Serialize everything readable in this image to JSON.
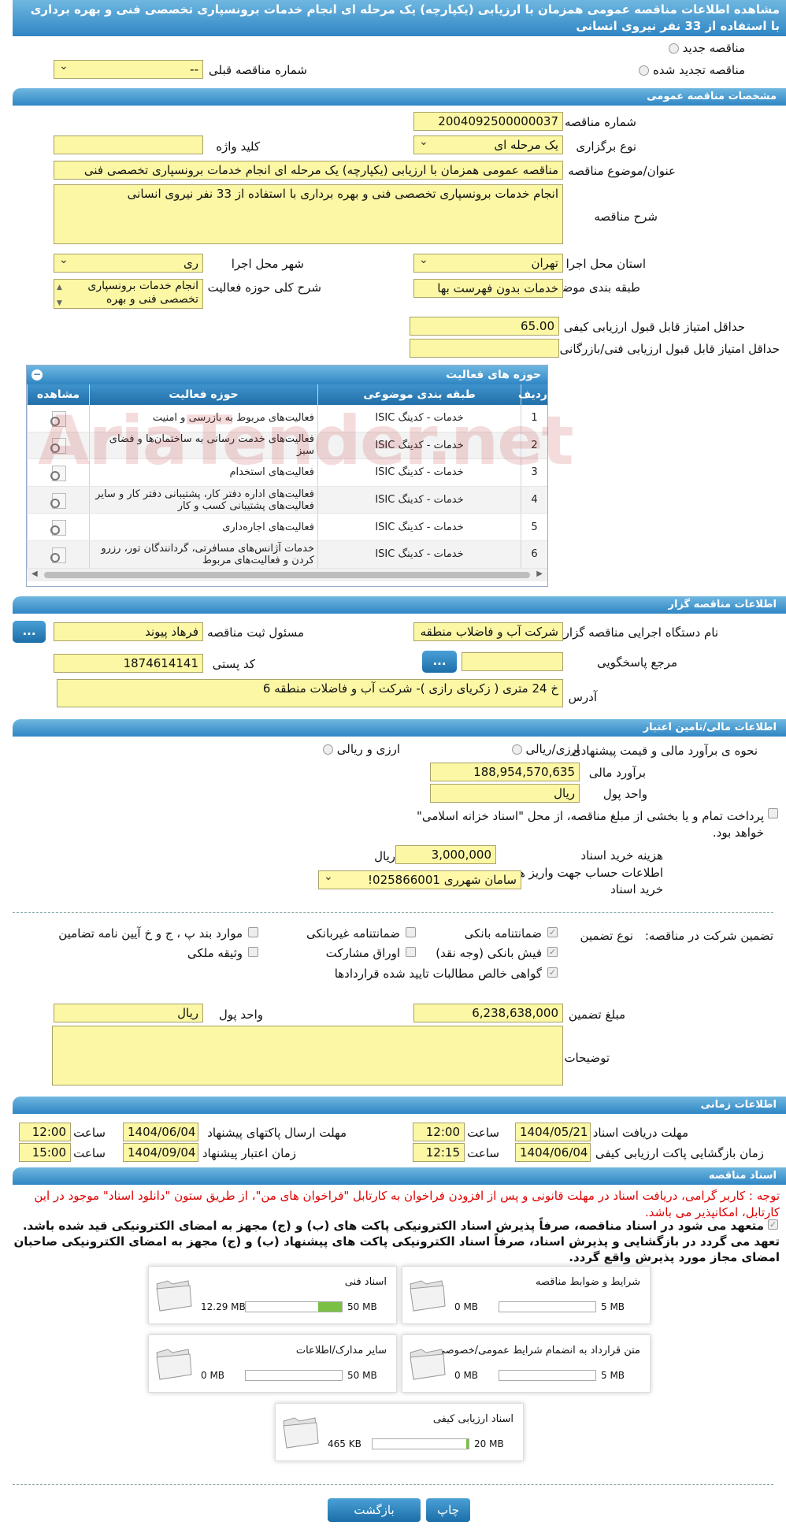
{
  "header": {
    "title": "مشاهده اطلاعات مناقصه عمومی همزمان با ارزیابی (یکپارچه) یک مرحله ای انجام خدمات برونسپاری تخصصی فنی و بهره برداری با استفاده از 33 نفر نیروی انسانی",
    "radio_new": "مناقصه جدید",
    "radio_renewed": "مناقصه تجدید شده",
    "prev_number_label": "شماره مناقصه قبلی",
    "prev_number_value": "--"
  },
  "general": {
    "section": "مشخصات مناقصه عمومی",
    "number_label": "شماره مناقصه",
    "number_value": "2004092500000037",
    "type_label": "نوع برگزاری",
    "type_value": "یک مرحله ای",
    "keyword_label": "کلید واژه",
    "keyword_value": "",
    "subject_label": "عنوان/موضوع مناقصه",
    "subject_value": "مناقصه عمومی همزمان با ارزیابی (یکپارچه) یک مرحله ای انجام خدمات برونسپاری تخصصی فنی",
    "desc_label": "شرح مناقصه",
    "desc_value": "انجام خدمات برونسپاری تخصصی فنی و بهره برداری با استفاده از 33 نفر نیروی انسانی",
    "province_label": "استان محل اجرا",
    "province_value": "تهران",
    "city_label": "شهر محل اجرا",
    "city_value": "ری",
    "category_label": "طبقه بندی موضوعی",
    "category_value": "خدمات بدون فهرست بها",
    "activity_label": "شرح کلی حوزه فعالیت",
    "activity_value": "انجام خدمات برونسپاری تخصصی فنی و بهره",
    "min_quality_label": "حداقل امتیاز قابل قبول ارزیابی کیفی",
    "min_quality_value": "65.00",
    "min_tech_label": "حداقل امتیاز قابل قبول ارزیابی فنی/بازرگانی",
    "min_tech_value": ""
  },
  "activities": {
    "title": "حوزه های فعالیت",
    "headers": [
      "ردیف",
      "طبقه بندی موضوعی",
      "حوزه فعالیت",
      "مشاهده"
    ],
    "rows": [
      {
        "n": "1",
        "cat": "خدمات - کدینگ ISIC",
        "area": "فعالیت‌های مربوط به بازرسی و امنیت"
      },
      {
        "n": "2",
        "cat": "خدمات - کدینگ ISIC",
        "area": "فعالیت‌های خدمت رسانی به ساختمان‌ها و فضای سبز"
      },
      {
        "n": "3",
        "cat": "خدمات - کدینگ ISIC",
        "area": "فعالیت‌های استخدام"
      },
      {
        "n": "4",
        "cat": "خدمات - کدینگ ISIC",
        "area": "فعالیت‌های اداره دفتر کار، پشتیبانی دفتر کار و سایر فعالیت‌های پشتیبانی کسب و کار"
      },
      {
        "n": "5",
        "cat": "خدمات - کدینگ ISIC",
        "area": "فعالیت‌های اجاره‌داری"
      },
      {
        "n": "6",
        "cat": "خدمات - کدینگ ISIC",
        "area": "خدمات آژانس‌های مسافرتی، گردانندگان تور، رزرو کردن و فعالیت‌های مربوط"
      }
    ]
  },
  "organizer": {
    "section": "اطلاعات مناقصه گزار",
    "org_label": "نام دستگاه اجرایی مناقصه گزار",
    "org_value": "شرکت آب و فاضلاب منطقه",
    "resp_label": "مسئول ثبت مناقصه",
    "resp_value": "فرهاد پیوند",
    "ref_label": "مرجع پاسخگویی",
    "ref_value": "",
    "postal_label": "کد پستی",
    "postal_value": "1874614141",
    "address_label": "آدرس",
    "address_value": "خ 24 متری ( زکریای رازی )- شرکت آب و فاضلات منطقه 6",
    "dots": "..."
  },
  "finance": {
    "section": "اطلاعات مالی/تامین اعتبار",
    "method_label": "نحوه ی برآورد مالی و قیمت پیشنهادی",
    "opt_rial": "ارزی/ریالی",
    "opt_fx": "ارزی و ریالی",
    "estimate_label": "برآورد مالی",
    "estimate_value": "188,954,570,635",
    "unit_label": "واحد پول",
    "unit_value": "ریال",
    "treasury_text": "پرداخت تمام و یا بخشی از مبلغ مناقصه، از محل \"اسناد خزانه اسلامی\" خواهد بود.",
    "doc_fee_label": "هزینه خرید اسناد",
    "doc_fee_value": "3,000,000",
    "doc_fee_unit": "ریال",
    "account_label": "اطلاعات حساب جهت واریز هزینه خرید اسناد",
    "account_value": "سامان شهرری 025866001!"
  },
  "guarantee": {
    "label": "تضمین شرکت در مناقصه:",
    "type_label": "نوع تضمین",
    "opt_bank_guarantee": "ضمانتنامه بانکی",
    "opt_nonbank": "ضمانتنامه غیربانکی",
    "opt_clauses": "موارد بند پ ، ج و خ آیین نامه تضامین",
    "opt_cash": "فیش بانکی (وجه نقد)",
    "opt_bonds": "اوراق مشارکت",
    "opt_property": "وثیقه ملکی",
    "opt_receivables": "گواهی خالص مطالبات تایید شده قراردادها",
    "amount_label": "مبلغ تضمین",
    "amount_value": "6,238,638,000",
    "unit_label": "واحد پول",
    "unit_value": "ریال",
    "notes_label": "توضیحات",
    "notes_value": ""
  },
  "timing": {
    "section": "اطلاعات زمانی",
    "doc_deadline_label": "مهلت دریافت اسناد",
    "doc_deadline_date": "1404/05/21",
    "doc_deadline_time": "12:00",
    "submit_deadline_label": "مهلت ارسال پاکتهای پیشنهاد",
    "submit_deadline_date": "1404/06/04",
    "submit_deadline_time": "12:00",
    "open_label": "زمان بازگشایی پاکت ارزیابی کیفی",
    "open_date": "1404/06/04",
    "open_time": "12:15",
    "validity_label": "زمان اعتبار پیشنهاد",
    "validity_date": "1404/09/04",
    "validity_time": "15:00",
    "time_label": "ساعت"
  },
  "docs": {
    "section": "اسناد مناقصه",
    "notice": "توجه : کاربر گرامی، دریافت اسناد در مهلت قانونی و پس از افزودن فراخوان به کارتابل \"فراخوان های من\"، از طریق ستون \"دانلود اسناد\" موجود در این کارتابل، امکانپذیر می باشد.",
    "commitment": "متعهد می شود در اسناد مناقصه، صرفاً پذیرش اسناد الکترونیکی پاکت های (ب) و (ج) مجهز به امضای الکترونیکی قید شده باشد. تعهد می گردد در بازگشایی و پذیرش اسناد، صرفاً اسناد الکترونیکی پاکت های پیشنهاد (ب) و (ج) مجهز به امضای الکترونیکی صاحبان امضای مجاز مورد پذیرش واقع گردد.",
    "files": [
      {
        "title": "شرایط و ضوابط مناقصه",
        "used": "0 MB",
        "max": "5 MB",
        "ratio": 0
      },
      {
        "title": "اسناد فنی",
        "used": "12.29 MB",
        "max": "50 MB",
        "ratio": 0.246
      },
      {
        "title": "متن قرارداد به انضمام شرایط عمومی/خصوصی",
        "used": "0 MB",
        "max": "5 MB",
        "ratio": 0
      },
      {
        "title": "سایر مدارک/اطلاعات",
        "used": "0 MB",
        "max": "50 MB",
        "ratio": 0
      },
      {
        "title": "اسناد ارزیابی کیفی",
        "used": "465 KB",
        "max": "20 MB",
        "ratio": 0.023
      }
    ]
  },
  "buttons": {
    "print": "چاپ",
    "back": "بازگشت"
  },
  "watermark": "AriaTender.net"
}
